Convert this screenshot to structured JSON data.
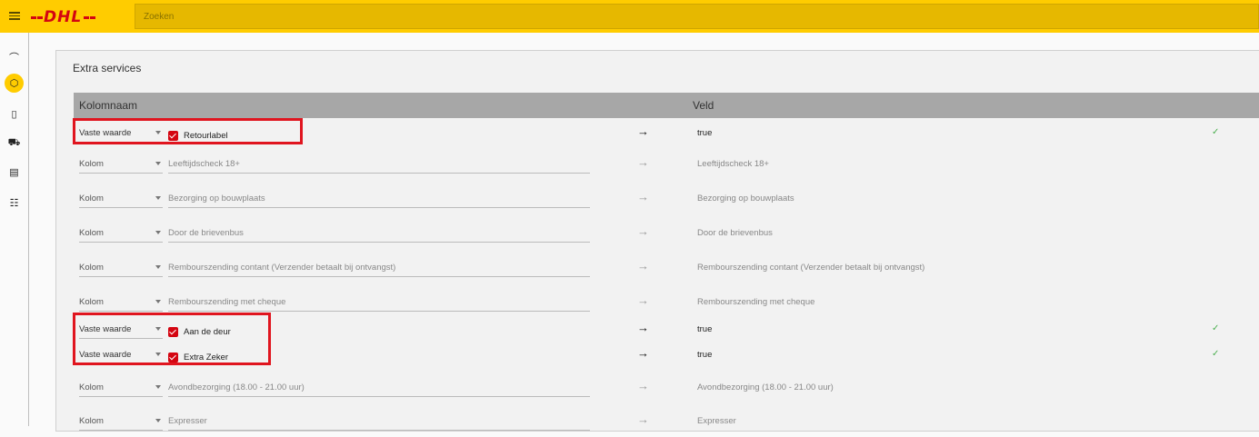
{
  "header": {
    "logo_text": "DHL",
    "search_placeholder": "Zoeken"
  },
  "colors": {
    "brand_yellow": "#ffcc00",
    "brand_red": "#d40511",
    "highlight_red": "#e0151f",
    "check_green": "#4caf50"
  },
  "sidebar": {
    "items": [
      {
        "icon": "gauge-icon",
        "glyph": "⌒"
      },
      {
        "icon": "package-icon",
        "glyph": "⬡",
        "active": true
      },
      {
        "icon": "book-icon",
        "glyph": "▯"
      },
      {
        "icon": "truck-icon",
        "glyph": "⛟"
      },
      {
        "icon": "clipboard-icon",
        "glyph": "▤"
      },
      {
        "icon": "sliders-icon",
        "glyph": "☷"
      }
    ]
  },
  "section": {
    "title": "Extra services",
    "col_name_header": "Kolomnaam",
    "field_header": "Veld",
    "arrow": "→",
    "check_mark": "✓",
    "rows": [
      {
        "source": "Vaste waarde",
        "label": "Retourlabel",
        "checked": true,
        "field": "true"
      },
      {
        "source": "Kolom",
        "label": "Leeftijdscheck 18+",
        "field": "Leeftijdscheck 18+"
      },
      {
        "source": "Kolom",
        "label": "Bezorging op bouwplaats",
        "field": "Bezorging op bouwplaats"
      },
      {
        "source": "Kolom",
        "label": "Door de brievenbus",
        "field": "Door de brievenbus"
      },
      {
        "source": "Kolom",
        "label": "Rembourszending contant (Verzender betaalt bij ontvangst)",
        "field": "Rembourszending contant (Verzender betaalt bij ontvangst)"
      },
      {
        "source": "Kolom",
        "label": "Rembourszending met cheque",
        "field": "Rembourszending met cheque"
      },
      {
        "source": "Vaste waarde",
        "label": "Aan de deur",
        "checked": true,
        "field": "true"
      },
      {
        "source": "Vaste waarde",
        "label": "Extra Zeker",
        "checked": true,
        "field": "true"
      },
      {
        "source": "Kolom",
        "label": "Avondbezorging (18.00 - 21.00 uur)",
        "field": "Avondbezorging (18.00 - 21.00 uur)"
      },
      {
        "source": "Kolom",
        "label": "Expresser",
        "field": "Expresser"
      }
    ]
  }
}
